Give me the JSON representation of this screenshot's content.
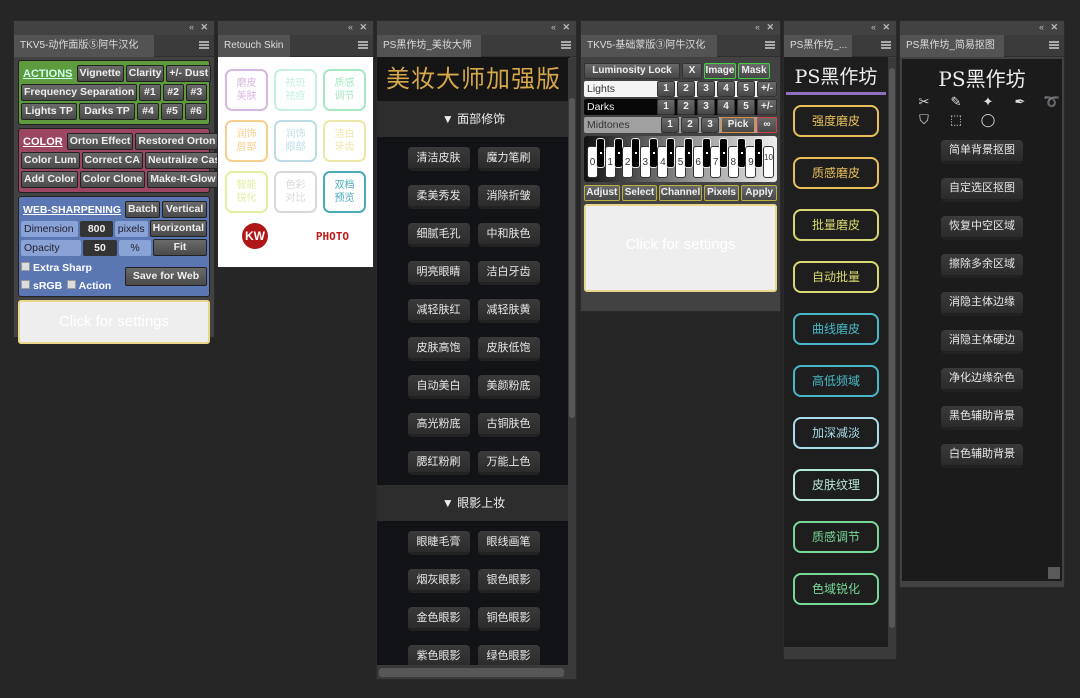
{
  "panel_controls": {
    "collapse": "«",
    "close": "✕"
  },
  "p1": {
    "tab": "TKV5-动作面版⑤阿牛汉化",
    "actions": {
      "header": "ACTIONS",
      "row1": [
        "Vignette",
        "Clarity",
        "+/- Dust"
      ],
      "row2": [
        "Frequency Separation",
        "#1",
        "#2",
        "#3"
      ],
      "row3": [
        "Lights TP",
        "Darks TP",
        "#4",
        "#5",
        "#6"
      ]
    },
    "color": {
      "header": "COLOR",
      "row1": [
        "Orton Effect",
        "Restored Orton"
      ],
      "row2": [
        "Color Lum",
        "Correct CA",
        "Neutralize Cast"
      ],
      "row3": [
        "Add Color",
        "Color Clone",
        "Make-It-Glow"
      ]
    },
    "web": {
      "header": "WEB-SHARPENING",
      "batch": "Batch",
      "vertical": "Vertical",
      "dimension_label": "Dimension",
      "dimension_value": "800",
      "pixels": "pixels",
      "horizontal": "Horizontal",
      "opacity_label": "Opacity",
      "opacity_value": "50",
      "percent": "%",
      "fit": "Fit",
      "extra_sharp": "Extra Sharp",
      "srgb": "sRGB",
      "action": "Action",
      "save_web": "Save for Web"
    },
    "settings": "Click for settings",
    "colors": {
      "actions": "#5e9a3e",
      "color": "#9c4662",
      "web": "#5a77b4"
    }
  },
  "p2": {
    "tab": "Retouch Skin",
    "buttons": [
      {
        "label": "磨皮美肤",
        "color": "#d8b8e0"
      },
      {
        "label": "祛斑祛痘",
        "color": "#c4f0e4"
      },
      {
        "label": "质感调节",
        "color": "#a6e8c2"
      },
      {
        "label": "润饰唇部",
        "color": "#f5cf8e"
      },
      {
        "label": "润饰眼部",
        "color": "#bcdde8"
      },
      {
        "label": "洁白牙齿",
        "color": "#ece8a8"
      },
      {
        "label": "智能锐化",
        "color": "#e0f0a0"
      },
      {
        "label": "色彩对比",
        "color": "#d8d8d8"
      },
      {
        "label": "双档预览",
        "color": "#4aaab8"
      }
    ],
    "logo_kw": "KW",
    "logo_photo": "PHOTO"
  },
  "p3": {
    "tab": "PS黑作坊_美妆大师",
    "title": "美妆大师加强版",
    "sections": [
      {
        "label": "▼ 面部修饰",
        "buttons": [
          "清洁皮肤",
          "魔力笔刷",
          "柔美秀发",
          "消除折皱",
          "细腻毛孔",
          "中和肤色",
          "明亮眼睛",
          "洁白牙齿",
          "减轻肤红",
          "减轻肤黄",
          "皮肤高饱",
          "皮肤低饱",
          "自动美白",
          "美颜粉底",
          "高光粉底",
          "古铜肤色",
          "腮红粉刷",
          "万能上色"
        ]
      },
      {
        "label": "▼ 眼影上妆",
        "buttons": [
          "眼睫毛膏",
          "眼线画笔",
          "烟灰眼影",
          "银色眼影",
          "金色眼影",
          "铜色眼影",
          "紫色眼影",
          "绿色眼影"
        ]
      }
    ]
  },
  "p4": {
    "tab": "TKV5-基础蒙版③阿牛汉化",
    "lum_lock": "Luminosity Lock",
    "x": "X",
    "image": "Image",
    "mask": "Mask",
    "lights": "Lights",
    "darks": "Darks",
    "midtones": "Midtones",
    "nums": [
      "1",
      "2",
      "3",
      "4",
      "5",
      "+/-"
    ],
    "mid_nums": [
      "1",
      "2",
      "3"
    ],
    "pick": "Pick",
    "link": "∞",
    "keys": [
      "0",
      "1",
      "2",
      "3",
      "4",
      "5",
      "6",
      "7",
      "8",
      "9",
      "10"
    ],
    "bottom": [
      "Adjust",
      "Select",
      "Channel",
      "Pixels",
      "Apply"
    ],
    "settings": "Click for settings"
  },
  "p5": {
    "tab": "PS黑作坊_...",
    "logo": "PS黑作坊",
    "buttons": [
      {
        "label": "强度磨皮",
        "color": "#e8c05a"
      },
      {
        "label": "质感磨皮",
        "color": "#e8c05a"
      },
      {
        "label": "批量磨皮",
        "color": "#d8d870"
      },
      {
        "label": "自动批量",
        "color": "#d8d870"
      },
      {
        "label": "曲线磨皮",
        "color": "#48b8c8"
      },
      {
        "label": "高低频域",
        "color": "#48b8c8"
      },
      {
        "label": "加深减淡",
        "color": "#a8dce8"
      },
      {
        "label": "皮肤纹理",
        "color": "#b8e8d8"
      },
      {
        "label": "质感调节",
        "color": "#78d898"
      },
      {
        "label": "色域锐化",
        "color": "#78d898"
      }
    ]
  },
  "p6": {
    "tab": "PS黑作坊_简易抠图",
    "logo": "PS黑作坊",
    "tools": [
      "eraser-icon",
      "brush-icon",
      "magic-wand-icon",
      "pen-icon",
      "lasso-icon",
      "polygon-lasso-icon",
      "rect-marquee-icon",
      "ellipse-marquee-icon"
    ],
    "tool_glyphs": [
      "✂",
      "✎",
      "✦",
      "✒",
      "➰",
      "⛉",
      "⬚",
      "◯"
    ],
    "buttons": [
      "简单背景抠图",
      "自定选区抠图",
      "恢复中空区域",
      "擦除多余区域",
      "消隐主体边缘",
      "消隐主体硬边",
      "净化边缘杂色",
      "黑色辅助背景",
      "白色辅助背景"
    ]
  }
}
